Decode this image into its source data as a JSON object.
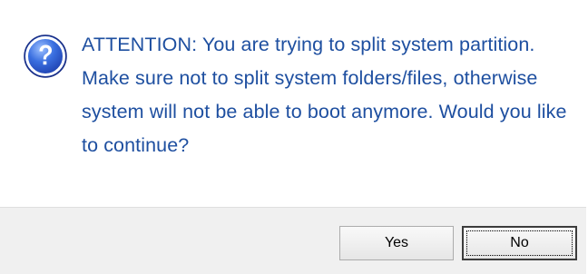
{
  "dialog": {
    "icon": "question-icon",
    "message": "ATTENTION: You are trying to split system partition. Make sure not to split system folders/files, otherwise system will not be able to boot anymore. Would you like to continue?",
    "message_color": "#1e4fa0",
    "buttons": {
      "yes_label": "Yes",
      "no_label": "No"
    }
  }
}
